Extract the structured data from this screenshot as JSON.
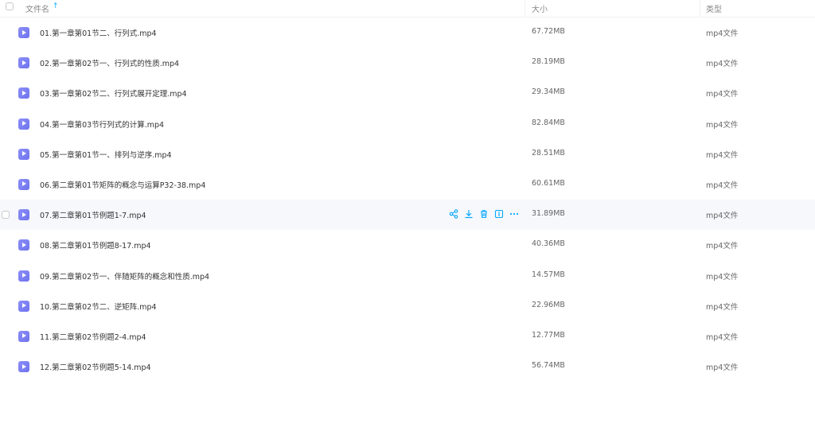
{
  "header": {
    "name_label": "文件名",
    "size_label": "大小",
    "type_label": "类型",
    "sort_indicator": "↑"
  },
  "accent_color": "#06a7ff",
  "files": [
    {
      "name": "01.第一章第01节二、行列式.mp4",
      "size": "67.72MB",
      "type": "mp4文件"
    },
    {
      "name": "02.第一章第02节一、行列式的性质.mp4",
      "size": "28.19MB",
      "type": "mp4文件"
    },
    {
      "name": "03.第一章第02节二、行列式展开定理.mp4",
      "size": "29.34MB",
      "type": "mp4文件"
    },
    {
      "name": "04.第一章第03节行列式的计算.mp4",
      "size": "82.84MB",
      "type": "mp4文件"
    },
    {
      "name": "05.第一章第01节一、排列与逆序.mp4",
      "size": "28.51MB",
      "type": "mp4文件"
    },
    {
      "name": "06.第二章第01节矩阵的概念与运算P32-38.mp4",
      "size": "60.61MB",
      "type": "mp4文件"
    },
    {
      "name": "07.第二章第01节例题1-7.mp4",
      "size": "31.89MB",
      "type": "mp4文件"
    },
    {
      "name": "08.第二章第01节例题8-17.mp4",
      "size": "40.36MB",
      "type": "mp4文件"
    },
    {
      "name": "09.第二章第02节一、伴随矩阵的概念和性质.mp4",
      "size": "14.57MB",
      "type": "mp4文件"
    },
    {
      "name": "10.第二章第02节二、逆矩阵.mp4",
      "size": "22.96MB",
      "type": "mp4文件"
    },
    {
      "name": "11.第二章第02节例题2-4.mp4",
      "size": "12.77MB",
      "type": "mp4文件"
    },
    {
      "name": "12.第二章第02节例题5-14.mp4",
      "size": "56.74MB",
      "type": "mp4文件"
    }
  ],
  "row_actions": [
    "share-icon",
    "download-icon",
    "delete-icon",
    "info-icon",
    "more-icon"
  ]
}
